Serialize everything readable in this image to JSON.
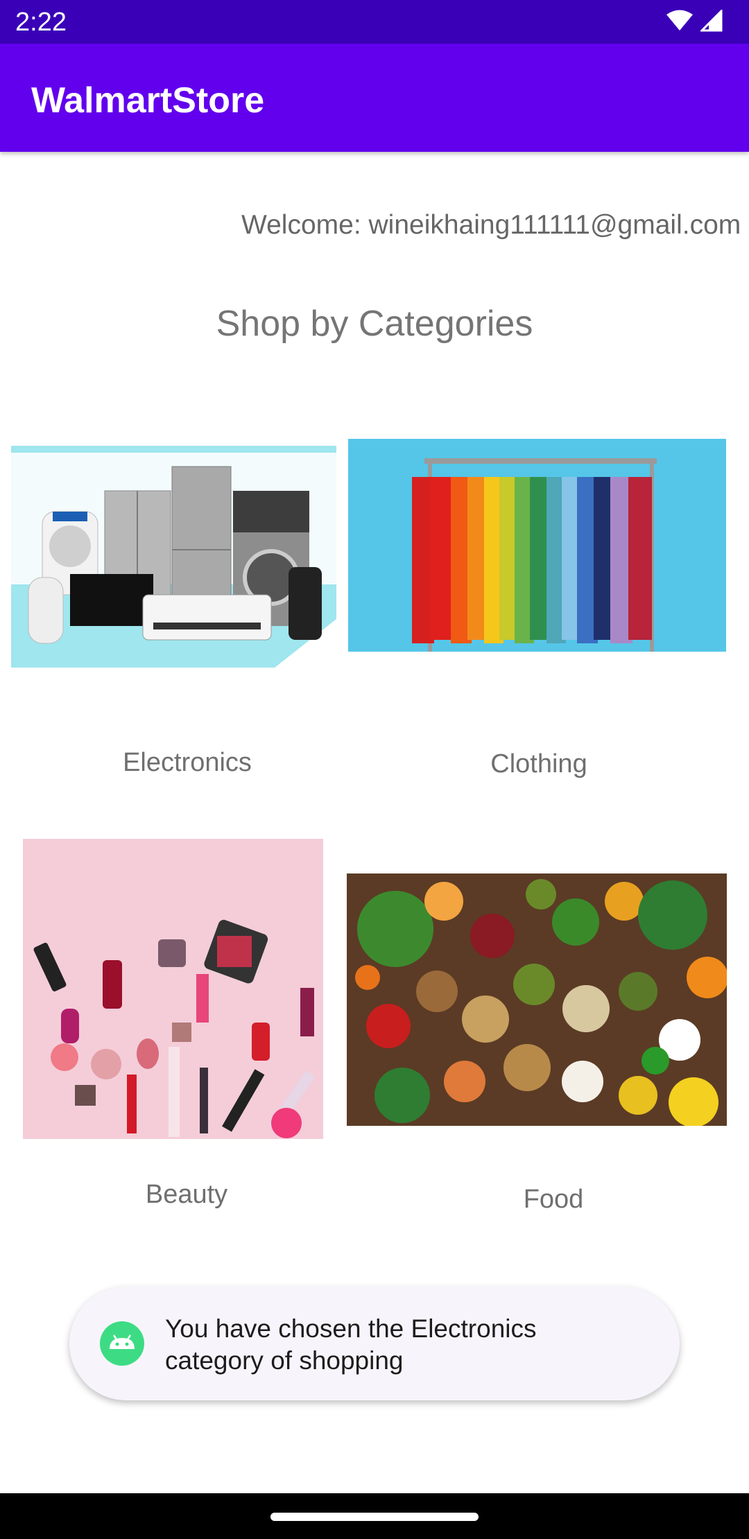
{
  "status_bar": {
    "time": "2:22",
    "icons": [
      "wifi-icon",
      "signal-icon"
    ]
  },
  "app_bar": {
    "title": "WalmartStore",
    "color": "#6200ee"
  },
  "welcome": "Welcome: wineikhaing111111@gmail.com",
  "section_title": "Shop by Categories",
  "categories": [
    {
      "label": "Electronics",
      "image": "electronics-image"
    },
    {
      "label": "Clothing",
      "image": "clothing-image"
    },
    {
      "label": "Beauty",
      "image": "beauty-image"
    },
    {
      "label": "Food",
      "image": "food-image"
    }
  ],
  "toast": {
    "line1": "You have chosen the Electronics",
    "line2": "category of shopping",
    "icon": "android-icon"
  }
}
